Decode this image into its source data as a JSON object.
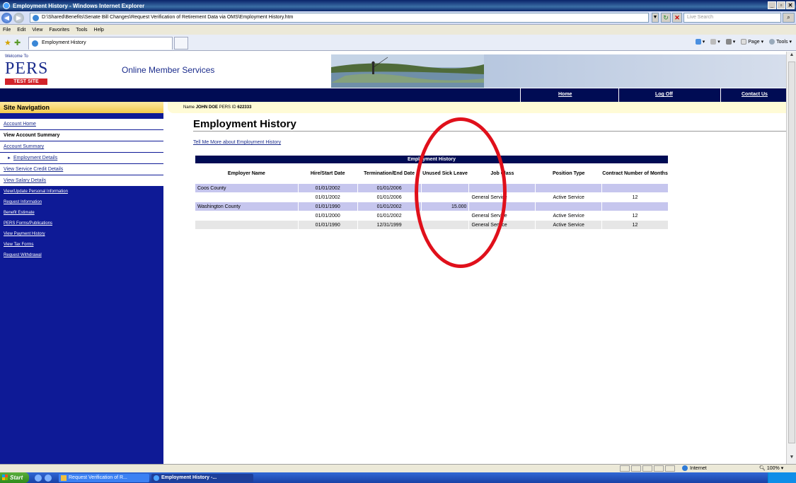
{
  "window": {
    "title": "Employment History - Windows Internet Explorer",
    "url": "D:\\Shared\\Benefits\\Senate Bill Changes\\Request Verification of Retirement Data via OMS\\Employment History.htm",
    "search_placeholder": "Live Search",
    "menu": [
      "File",
      "Edit",
      "View",
      "Favorites",
      "Tools",
      "Help"
    ],
    "tab_title": "Employment History",
    "commands": [
      "Page",
      "Tools"
    ]
  },
  "header": {
    "welcome": "Welcome To",
    "logo": "PERS",
    "test_site": "TEST SITE",
    "title": "Online Member Services"
  },
  "topnav": [
    "Home",
    "Log Off",
    "Contact Us"
  ],
  "sidebar": {
    "heading": "Site Navigation",
    "items": [
      {
        "label": "Account Home"
      },
      {
        "label": "View Account Summary"
      },
      {
        "label": "Account Summary"
      },
      {
        "label": "Employment Details"
      },
      {
        "label": "View Service Credit Details"
      },
      {
        "label": "View Salary Details"
      }
    ],
    "links": [
      "View/Update Personal Information",
      "Request Information",
      "Benefit Estimate",
      "PERS Forms/Publications",
      "View Payment History",
      "View Tax Forms",
      "Request Withdrawal"
    ]
  },
  "member": {
    "name_label": "Name",
    "name": "JOHN DOE",
    "id_label": "PERS ID",
    "id": "622333"
  },
  "page": {
    "title": "Employment History",
    "tell_more": "Tell Me More about Employment History"
  },
  "table": {
    "caption": "Employment History",
    "headers": [
      "Employer Name",
      "Hire/Start Date",
      "Termination/End Date",
      "Unused Sick Leave",
      "Job Class",
      "Position Type",
      "Contract Number of Months"
    ],
    "rows": [
      [
        "Coos County",
        "01/01/2002",
        "01/01/2006",
        "",
        "",
        "",
        ""
      ],
      [
        "",
        "01/01/2002",
        "01/01/2006",
        "",
        "General Service",
        "Active Service",
        "12"
      ],
      [
        "Washington County",
        "01/01/1990",
        "01/01/2002",
        "15.000",
        "",
        "",
        ""
      ],
      [
        "",
        "01/01/2000",
        "01/01/2002",
        "",
        "General Service",
        "Active Service",
        "12"
      ],
      [
        "",
        "01/01/1990",
        "12/31/1999",
        "",
        "General Service",
        "Active Service",
        "12"
      ]
    ]
  },
  "status": {
    "zone": "Internet",
    "zoom": "100%"
  },
  "taskbar": {
    "start": "Start",
    "buttons": [
      "Request Verification of R...",
      "Employment History -..."
    ]
  },
  "colors": {
    "navy": "#000c54",
    "sidebar": "#0e1a96",
    "row_highlight": "#c6c6ee",
    "row_gray": "#e6e6e6",
    "annotation": "#e0101b"
  }
}
